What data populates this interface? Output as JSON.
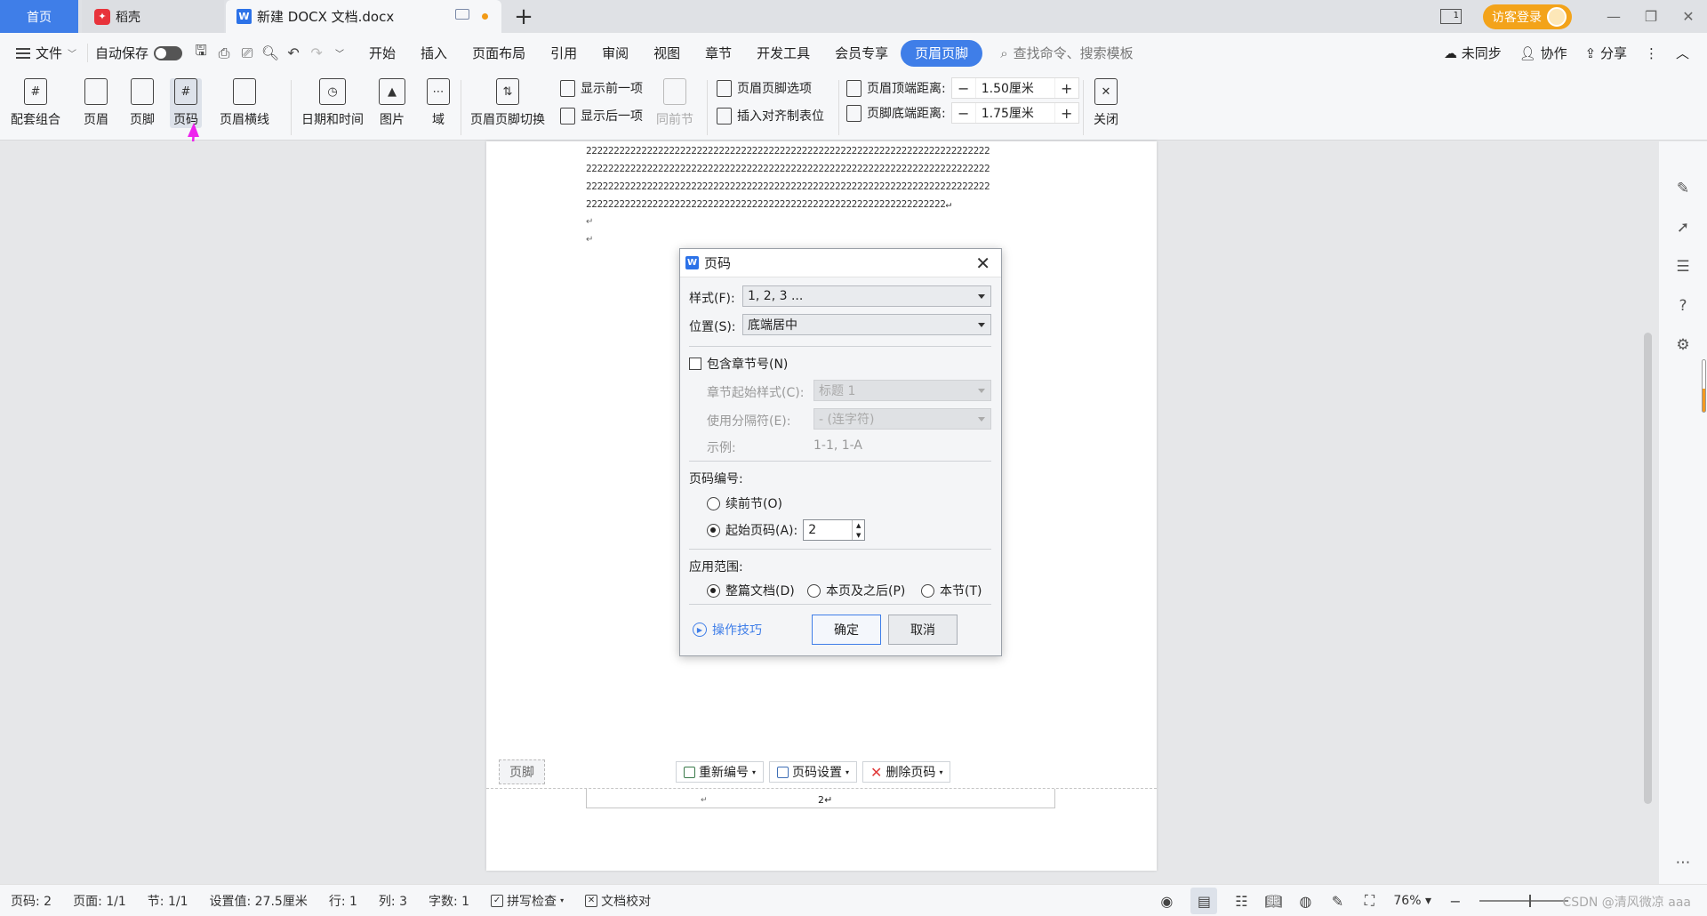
{
  "tabs": {
    "home": "首页",
    "daoke": "稻壳",
    "doc_title": "新建 DOCX 文档.docx",
    "add": "+"
  },
  "window": {
    "page_count_indicator": "1",
    "login": "访客登录",
    "minimize": "—",
    "restore": "❐",
    "close": "✕"
  },
  "menu": {
    "file": "文件",
    "autosave": "自动保存",
    "items": [
      "开始",
      "插入",
      "页面布局",
      "引用",
      "审阅",
      "视图",
      "章节",
      "开发工具",
      "会员专享",
      "页眉页脚"
    ],
    "active_index": 9,
    "search": "查找命令、搜索模板",
    "sync": "未同步",
    "collab": "协作",
    "share": "分享"
  },
  "ribbon": {
    "combo": "配套组合",
    "header": "页眉",
    "footer": "页脚",
    "page_number": "页码",
    "header_line": "页眉横线",
    "datetime": "日期和时间",
    "picture": "图片",
    "field": "域",
    "switch": "页眉页脚切换",
    "show_prev": "显示前一项",
    "show_next": "显示后一项",
    "same_prev": "同前节",
    "hf_options": "页眉页脚选项",
    "insert_tab": "插入对齐制表位",
    "header_top_label": "页眉顶端距离:",
    "header_top_value": "1.50厘米",
    "footer_bottom_label": "页脚底端距离:",
    "footer_bottom_value": "1.75厘米",
    "close": "关闭"
  },
  "document": {
    "lines": [
      "2222222222222222222222222222222222222222222222222222222222222222222222222",
      "2222222222222222222222222222222222222222222222222222222222222222222222222",
      "2222222222222222222222222222222222222222222222222222222222222222222222222",
      "22222222222222222222222222222222222222222222222222222222222222222↵"
    ],
    "para_marks": [
      "↵",
      "↵"
    ],
    "footer_label": "页脚",
    "footer_tools": [
      "重新编号",
      "页码设置",
      "删除页码"
    ],
    "footer_page_num": "2↵",
    "footer_left_mark": "↵"
  },
  "dialog": {
    "title": "页码",
    "style_label": "样式(F):",
    "style_value": "1, 2, 3 ...",
    "position_label": "位置(S):",
    "position_value": "底端居中",
    "include_chapter": "包含章节号(N)",
    "chapter_style_label": "章节起始样式(C):",
    "chapter_style_value": "标题 1",
    "separator_label": "使用分隔符(E):",
    "separator_value": "-    (连字符)",
    "example_label": "示例:",
    "example_value": "1-1, 1-A",
    "numbering_label": "页码编号:",
    "continue_prev": "续前节(O)",
    "start_at": "起始页码(A):",
    "start_value": "2",
    "scope_label": "应用范围:",
    "scope_whole": "整篇文档(D)",
    "scope_after": "本页及之后(P)",
    "scope_section": "本节(T)",
    "tips": "操作技巧",
    "ok": "确定",
    "cancel": "取消"
  },
  "status": {
    "page_num": "页码: 2",
    "pages": "页面: 1/1",
    "section": "节: 1/1",
    "setting": "设置值: 27.5厘米",
    "row": "行: 1",
    "col": "列: 3",
    "words": "字数: 1",
    "spell": "拼写检查",
    "proof": "文档校对",
    "zoom": "76%",
    "watermark": "CSDN @清风微凉 aaa"
  },
  "colors": {
    "accent": "#3f7ee8",
    "login": "#f3a31a",
    "annotation_arrow": "#ee22ee"
  }
}
